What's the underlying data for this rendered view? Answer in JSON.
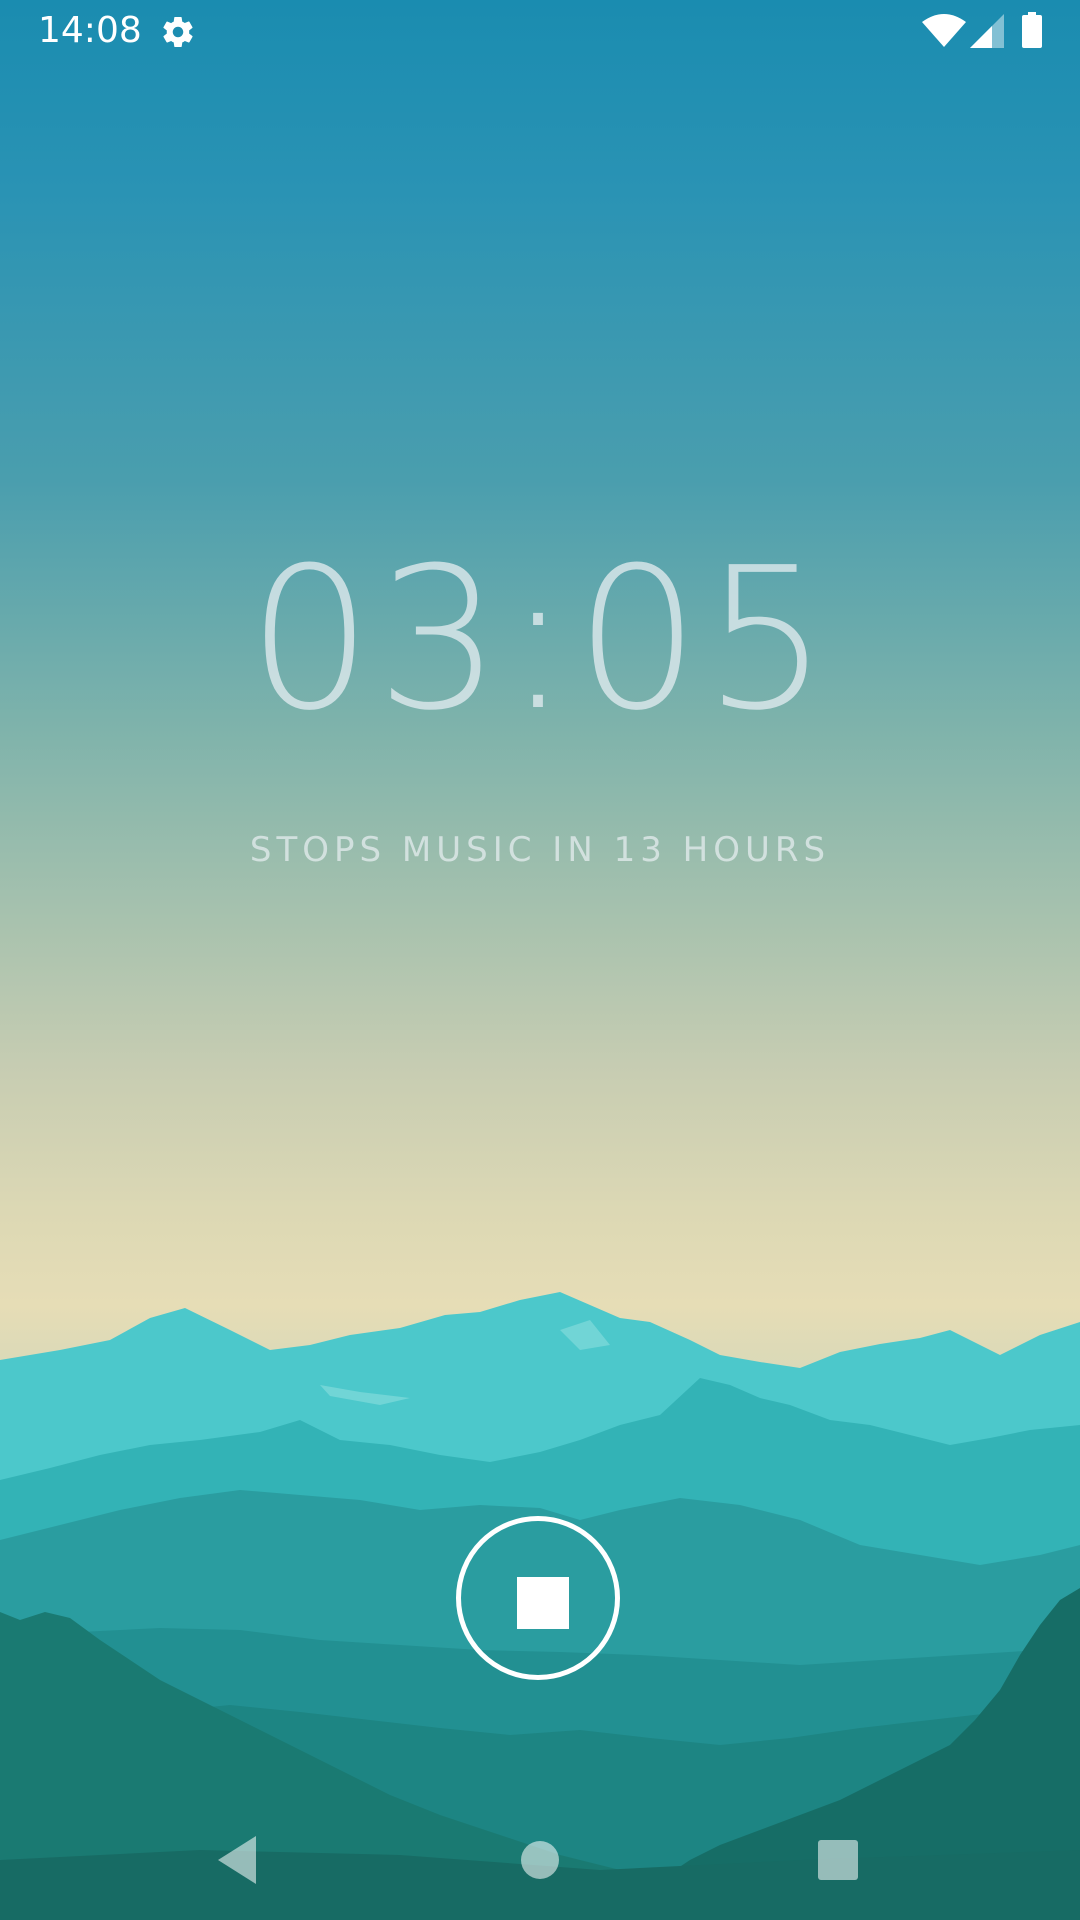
{
  "status_bar": {
    "time": "14:08",
    "icons": [
      "settings-icon",
      "wifi-icon",
      "signal-icon",
      "battery-icon"
    ]
  },
  "timer": {
    "display": "03:05",
    "subtitle": "STOPS MUSIC IN 13 HOURS"
  },
  "controls": {
    "stop_icon": "stop-icon"
  },
  "nav_bar": {
    "icons": [
      "back-icon",
      "home-icon",
      "recents-icon"
    ]
  },
  "colors": {
    "sky_top": "#1a8cb0",
    "horizon": "#e6ddb6",
    "mountain_far": "#47c6c9",
    "mountain_mid": "#2ea8ab",
    "mountain_near": "#1d7c78",
    "foreground": "#176862",
    "text_light": "#ffffff"
  }
}
